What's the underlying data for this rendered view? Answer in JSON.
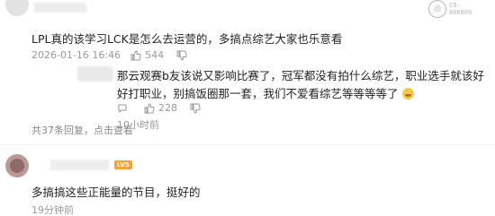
{
  "comment1": {
    "badge": {
      "line1": "CO.",
      "line2": "608800"
    },
    "text": "LPL真的该学习LCK是怎么去运营的，多搞点综艺大家也乐意看",
    "time": "2026-01-16 16:46",
    "likes": "544"
  },
  "reply": {
    "text": "那云观赛b友该说又影响比赛了，冠军都没有拍什么综艺，职业选手就该好好打职业，别搞饭圈那一套，我们不爱看综艺等等等等了",
    "likes": "228",
    "time": "10小时前"
  },
  "thread": {
    "total_label": "共37条回复，点击查看"
  },
  "comment2": {
    "level": "LV5",
    "text": "多搞搞这些正能量的节目，挺好的",
    "time": "19分钟前"
  },
  "colors": {
    "meta": "#999999",
    "level_badge": "#f0a33a"
  }
}
